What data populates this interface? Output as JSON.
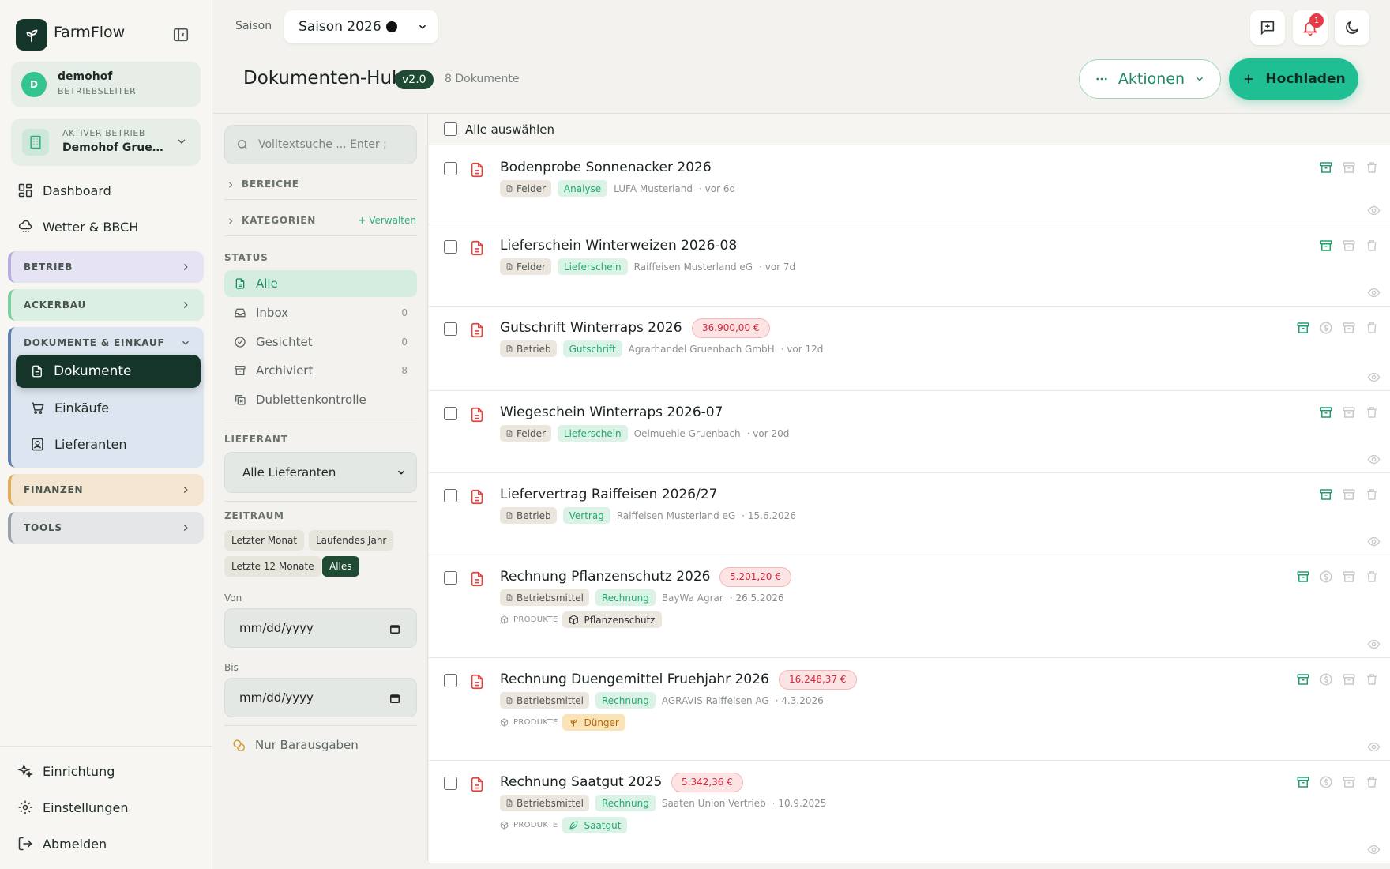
{
  "app": {
    "name": "FarmFlow"
  },
  "user": {
    "initial": "D",
    "name": "demohof",
    "role": "BETRIEBSLEITER"
  },
  "farm": {
    "label": "AKTIVER BETRIEB",
    "name": "Demohof Gruenfeld"
  },
  "nav": {
    "dashboard": "Dashboard",
    "weather": "Wetter & BBCH"
  },
  "sections": {
    "betrieb": "BETRIEB",
    "ackerbau": "ACKERBAU",
    "dokumente": "DOKUMENTE & EINKAUF",
    "finanzen": "FINANZEN",
    "tools": "TOOLS"
  },
  "sub": {
    "dokumente": "Dokumente",
    "einkaeufe": "Einkäufe",
    "lieferanten": "Lieferanten"
  },
  "bottom": {
    "setup": "Einrichtung",
    "settings": "Einstellungen",
    "logout": "Abmelden"
  },
  "topbar": {
    "season_label": "Saison",
    "season_value": "Saison 2026",
    "notifications_count": "1"
  },
  "header": {
    "title": "Dokumenten-Hub",
    "version": "v2.0",
    "doc_count": "8 Dokumente",
    "actions_label": "Aktionen",
    "upload_label": "Hochladen"
  },
  "filters": {
    "search_placeholder": "Volltextsuche ... Enter ;",
    "areas": "BEREICHE",
    "categories": "KATEGORIEN",
    "manage": "+ Verwalten",
    "status_head": "STATUS",
    "status": [
      {
        "label": "Alle",
        "count": ""
      },
      {
        "label": "Inbox",
        "count": "0"
      },
      {
        "label": "Gesichtet",
        "count": "0"
      },
      {
        "label": "Archiviert",
        "count": "8"
      },
      {
        "label": "Dublettenkontrolle",
        "count": ""
      }
    ],
    "supplier_head": "LIEFERANT",
    "supplier_value": "Alle Lieferanten",
    "period_head": "ZEITRAUM",
    "period_chips": [
      "Letzter Monat",
      "Laufendes Jahr",
      "Letzte 12 Monate",
      "Alles"
    ],
    "period_active": "Alles",
    "from_label": "Von",
    "to_label": "Bis",
    "date_placeholder": "mm/dd/yyyy",
    "cash_only": "Nur Barausgaben"
  },
  "list": {
    "select_all": "Alle auswählen",
    "products_label": "PRODUKTE",
    "documents": [
      {
        "title": "Bodenprobe Sonnenacker 2026",
        "area": "Felder",
        "category": "Analyse",
        "supplier": "LUFA Musterland",
        "date": "· vor 6d"
      },
      {
        "title": "Lieferschein Winterweizen 2026-08",
        "area": "Felder",
        "category": "Lieferschein",
        "supplier": "Raiffeisen Musterland eG",
        "date": "· vor 7d"
      },
      {
        "title": "Gutschrift Winterraps 2026",
        "amount": "36.900,00 €",
        "area": "Betrieb",
        "category": "Gutschrift",
        "supplier": "Agrarhandel Gruenbach GmbH",
        "date": "· vor 12d"
      },
      {
        "title": "Wiegeschein Winterraps 2026-07",
        "area": "Felder",
        "category": "Lieferschein",
        "supplier": "Oelmuehle Gruenbach",
        "date": "· vor 20d"
      },
      {
        "title": "Liefervertrag Raiffeisen 2026/27",
        "area": "Betrieb",
        "category": "Vertrag",
        "supplier": "Raiffeisen Musterland eG",
        "date": "· 15.6.2026"
      },
      {
        "title": "Rechnung Pflanzenschutz 2026",
        "amount": "5.201,20 €",
        "area": "Betriebsmittel",
        "category": "Rechnung",
        "supplier": "BayWa Agrar",
        "date": "· 26.5.2026",
        "product": "Pflanzenschutz"
      },
      {
        "title": "Rechnung Duengemittel Fruehjahr 2026",
        "amount": "16.248,37 €",
        "area": "Betriebsmittel",
        "category": "Rechnung",
        "supplier": "AGRAVIS Raiffeisen AG",
        "date": "· 4.3.2026",
        "product": "Dünger"
      },
      {
        "title": "Rechnung Saatgut 2025",
        "amount": "5.342,36 €",
        "area": "Betriebsmittel",
        "category": "Rechnung",
        "supplier": "Saaten Union Vertrieb",
        "date": "· 10.9.2025",
        "product": "Saatgut"
      }
    ]
  },
  "colors": {
    "brand_dark": "#16352a",
    "accent": "#20bf93",
    "danger": "#d7263d"
  }
}
